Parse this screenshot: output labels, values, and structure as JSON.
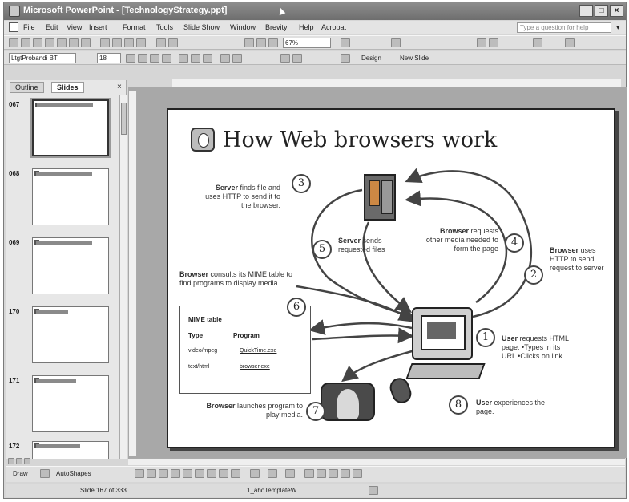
{
  "window": {
    "title": "Microsoft PowerPoint - [TechnologyStrategy.ppt]",
    "controls": [
      "minimize",
      "maximize",
      "close"
    ]
  },
  "menubar": {
    "items": [
      "File",
      "Edit",
      "View",
      "Insert",
      "Format",
      "Tools",
      "Slide Show",
      "Window",
      "Brevity",
      "Help",
      "Acrobat"
    ],
    "help_placeholder": "Type a question for help"
  },
  "formatting_toolbar": {
    "font": "LtgtProbandi BT",
    "size": "18",
    "zoom": "67%",
    "design_label": "Design",
    "new_slide_label": "New Slide"
  },
  "outline_pane": {
    "tabs": [
      "Outline",
      "Slides"
    ],
    "thumbnails": [
      {
        "number": "067",
        "selected": true
      },
      {
        "number": "068",
        "selected": false
      },
      {
        "number": "069",
        "selected": false
      },
      {
        "number": "170",
        "selected": false
      },
      {
        "number": "171",
        "selected": false
      },
      {
        "number": "172",
        "selected": false
      }
    ]
  },
  "slide": {
    "title": "How Web browsers work",
    "steps": {
      "s1": {
        "num": "1",
        "bold": "User",
        "text": " requests HTML page: •Types in its URL •Clicks on link"
      },
      "s2": {
        "num": "2",
        "bold": "Browser",
        "text": " uses HTTP to send request to server"
      },
      "s3": {
        "num": "3",
        "bold": "Server",
        "text": " finds file and uses HTTP to send it to the browser."
      },
      "s4": {
        "num": "4",
        "bold": "Browser",
        "text": " requests other media needed to form the page"
      },
      "s5": {
        "num": "5",
        "bold": "Server",
        "text": " sends requested files"
      },
      "s6": {
        "num": "6",
        "bold": "Browser",
        "text": " consults its MIME table to find programs to display media"
      },
      "s7": {
        "num": "7",
        "bold": "Browser",
        "text": " launches program to play media."
      },
      "s8": {
        "num": "8",
        "bold": "User",
        "text": " experiences the page."
      }
    },
    "mime_table": {
      "title": "MIME table",
      "col_type": "Type",
      "col_program": "Program",
      "rows": [
        {
          "type": "video/mpeg",
          "program": "QuickTime.exe"
        },
        {
          "type": "text/html",
          "program": "browser.exe"
        }
      ]
    }
  },
  "drawing_toolbar": {
    "draw_label": "Draw",
    "autoshapes_label": "AutoShapes"
  },
  "statusbar": {
    "slide_info": "Slide 167 of 333",
    "template": "1_ahoTemplateW"
  }
}
